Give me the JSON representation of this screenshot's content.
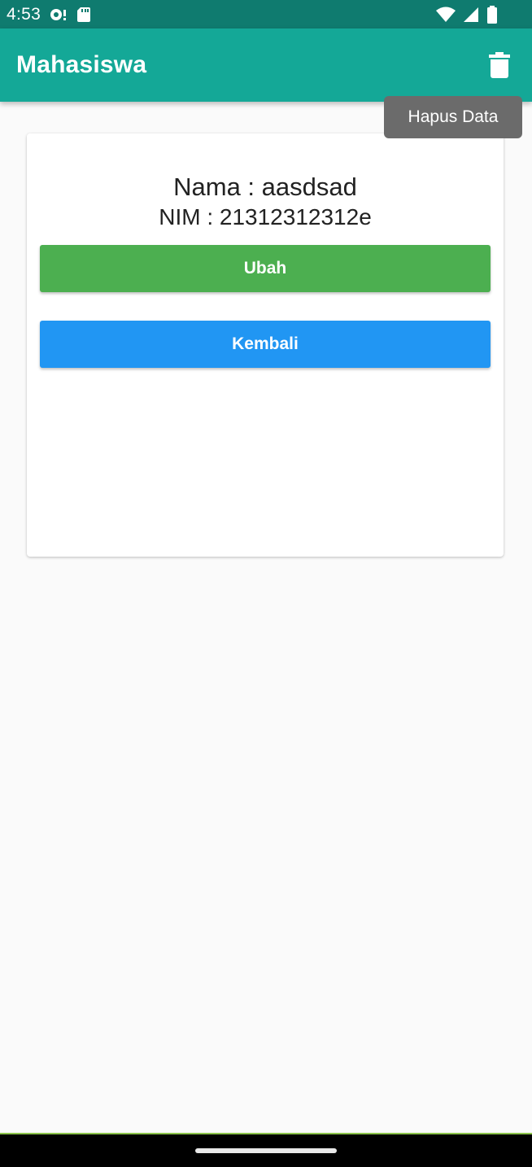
{
  "status_bar": {
    "time": "4:53",
    "icons_left": [
      "sync-icon",
      "sd-card-icon"
    ],
    "icons_right": [
      "wifi-icon",
      "signal-icon",
      "battery-icon"
    ]
  },
  "app_bar": {
    "title": "Mahasiswa",
    "action_icon": "trash-icon",
    "color": "#14a897"
  },
  "tooltip": {
    "text": "Hapus Data"
  },
  "card": {
    "nama_line": "Nama : aasdsad",
    "nim_line": "NIM : 21312312312e"
  },
  "buttons": {
    "ubah_label": "Ubah",
    "ubah_color": "#4caf50",
    "kembali_label": "Kembali",
    "kembali_color": "#2196f3"
  }
}
